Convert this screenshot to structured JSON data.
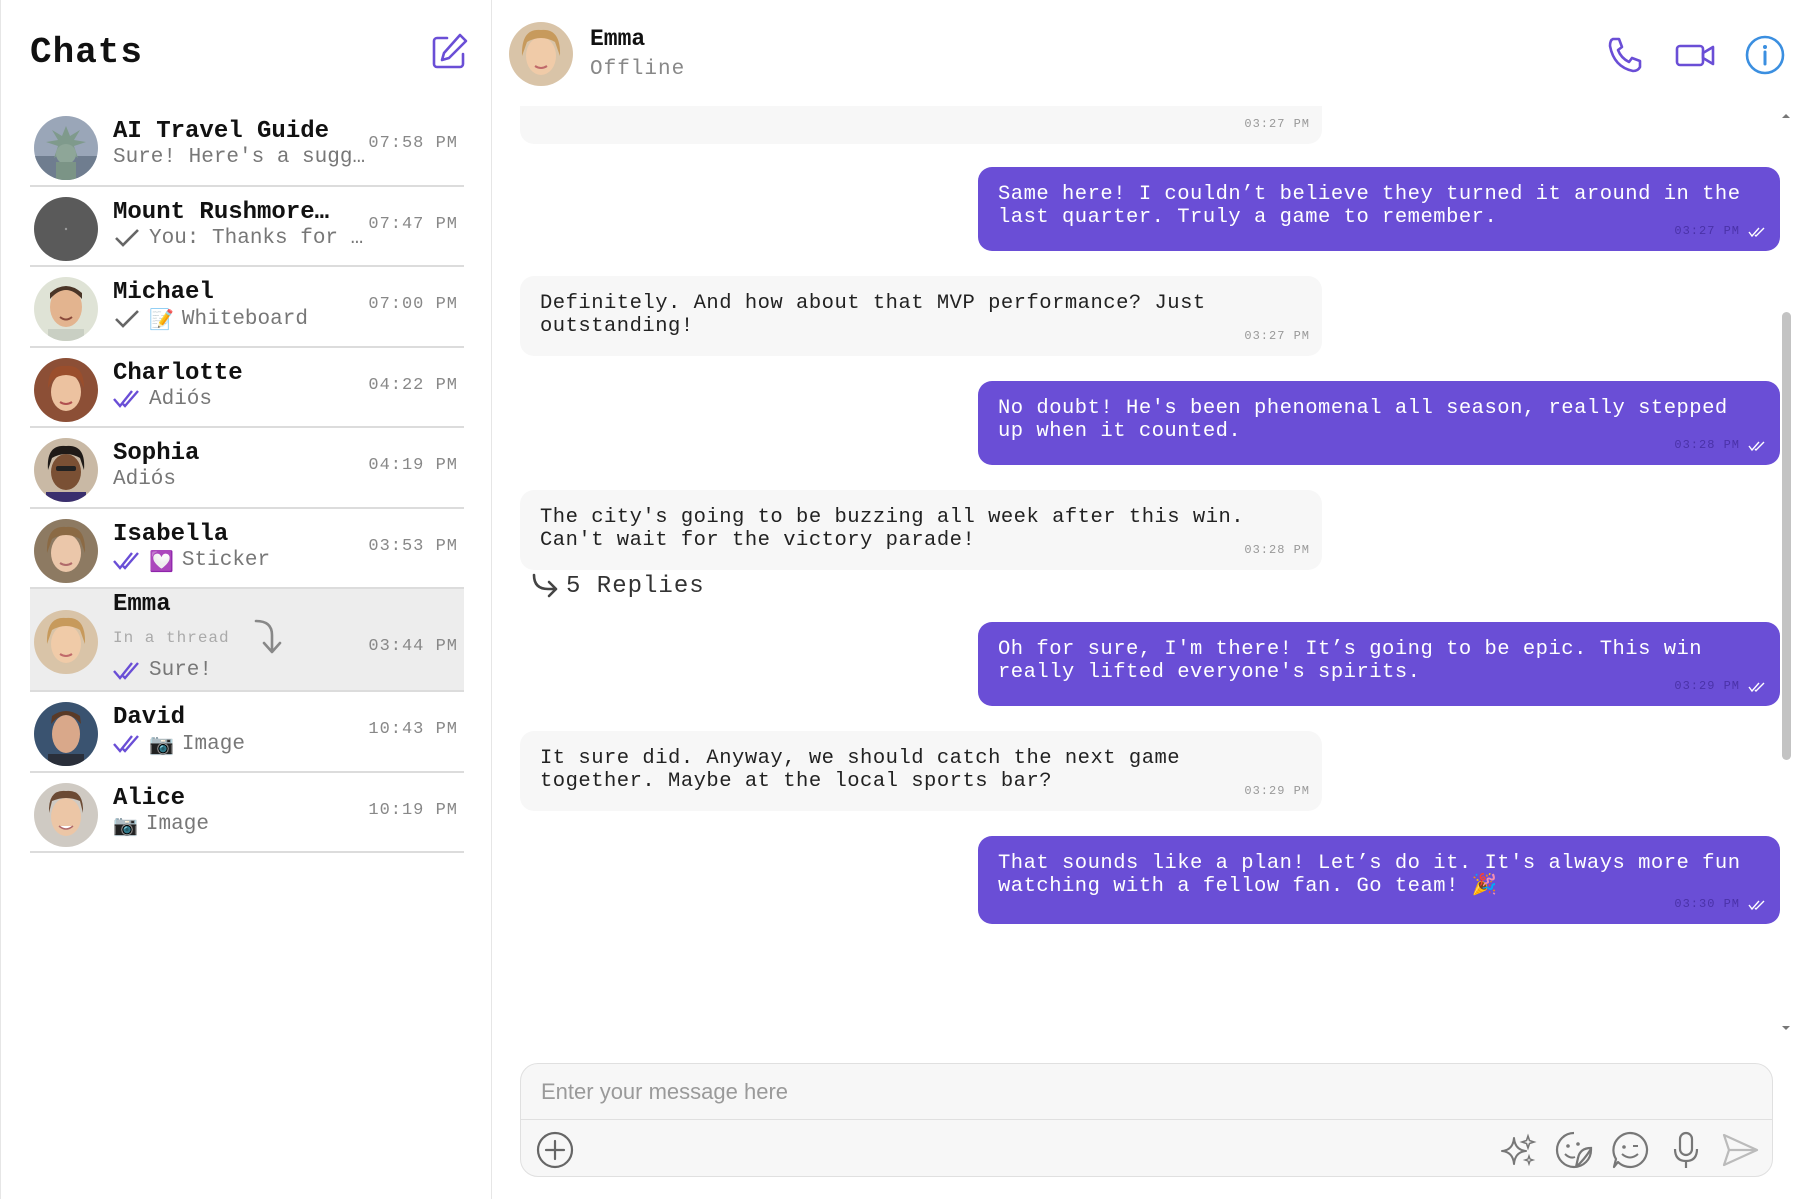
{
  "sidebar": {
    "title": "Chats",
    "chats": [
      {
        "name": "AI Travel Guide",
        "preview": "Sure! Here's a sugg…",
        "time": "07:58 PM",
        "check": "none"
      },
      {
        "name": "Mount Rushmore…",
        "preview": "You: Thanks for …",
        "time": "07:47 PM",
        "check": "single"
      },
      {
        "name": "Michael",
        "emoji": "📝",
        "preview": "Whiteboard",
        "time": "07:00 PM",
        "check": "single"
      },
      {
        "name": "Charlotte",
        "preview": "Adiós",
        "time": "04:22 PM",
        "check": "double"
      },
      {
        "name": "Sophia",
        "preview": "Adiós",
        "time": "04:19 PM",
        "check": "none"
      },
      {
        "name": "Isabella",
        "emoji": "💟",
        "preview": "Sticker",
        "time": "03:53 PM",
        "check": "double"
      },
      {
        "name": "Emma",
        "thread_hint": "In a thread",
        "preview": "Sure!",
        "time": "03:44 PM",
        "check": "double",
        "active": true
      },
      {
        "name": "David",
        "emoji": "📷",
        "preview": "Image",
        "time": "10:43 PM",
        "check": "double"
      },
      {
        "name": "Alice",
        "emoji": "📷",
        "preview": "Image",
        "time": "10:19 PM",
        "check": "none"
      }
    ]
  },
  "header": {
    "name": "Emma",
    "status": "Offline"
  },
  "messages": [
    {
      "dir": "in",
      "text": "",
      "time": "03:27 PM"
    },
    {
      "dir": "out",
      "text": "Same here! I couldn’t believe they turned it around in the last quarter. Truly a game to remember.",
      "time": "03:27 PM"
    },
    {
      "dir": "in",
      "text": "Definitely. And how about that MVP performance? Just outstanding!",
      "time": "03:27 PM"
    },
    {
      "dir": "out",
      "text": "No doubt! He's been phenomenal all season, really stepped up when it counted.",
      "time": "03:28 PM"
    },
    {
      "dir": "in",
      "text": "The city's going to be buzzing all week after this win. Can't wait for the victory parade!",
      "time": "03:28 PM",
      "replies": "5 Replies"
    },
    {
      "dir": "out",
      "text": "Oh for sure, I'm there! It’s going to be epic. This win really lifted everyone's spirits.",
      "time": "03:29 PM"
    },
    {
      "dir": "in",
      "text": "It sure did. Anyway, we should catch the next game together. Maybe at the local sports bar?",
      "time": "03:29 PM"
    },
    {
      "dir": "out",
      "text": "That sounds like a plan! Let’s do it. It's always more fun watching with a fellow fan. Go team! 🎉",
      "time": "03:30 PM"
    }
  ],
  "composer": {
    "placeholder": "Enter your message here"
  },
  "colors": {
    "accent": "#6a4ed6",
    "icon": "#6a4ed6",
    "info": "#3b8fe0"
  },
  "icons": [
    "compose-icon",
    "phone-icon",
    "video-icon",
    "info-icon",
    "plus-icon",
    "sparkle-icon",
    "sticker-icon",
    "emoji-icon",
    "mic-icon",
    "send-icon",
    "reply-arrow-icon",
    "check-icon",
    "double-check-icon"
  ]
}
